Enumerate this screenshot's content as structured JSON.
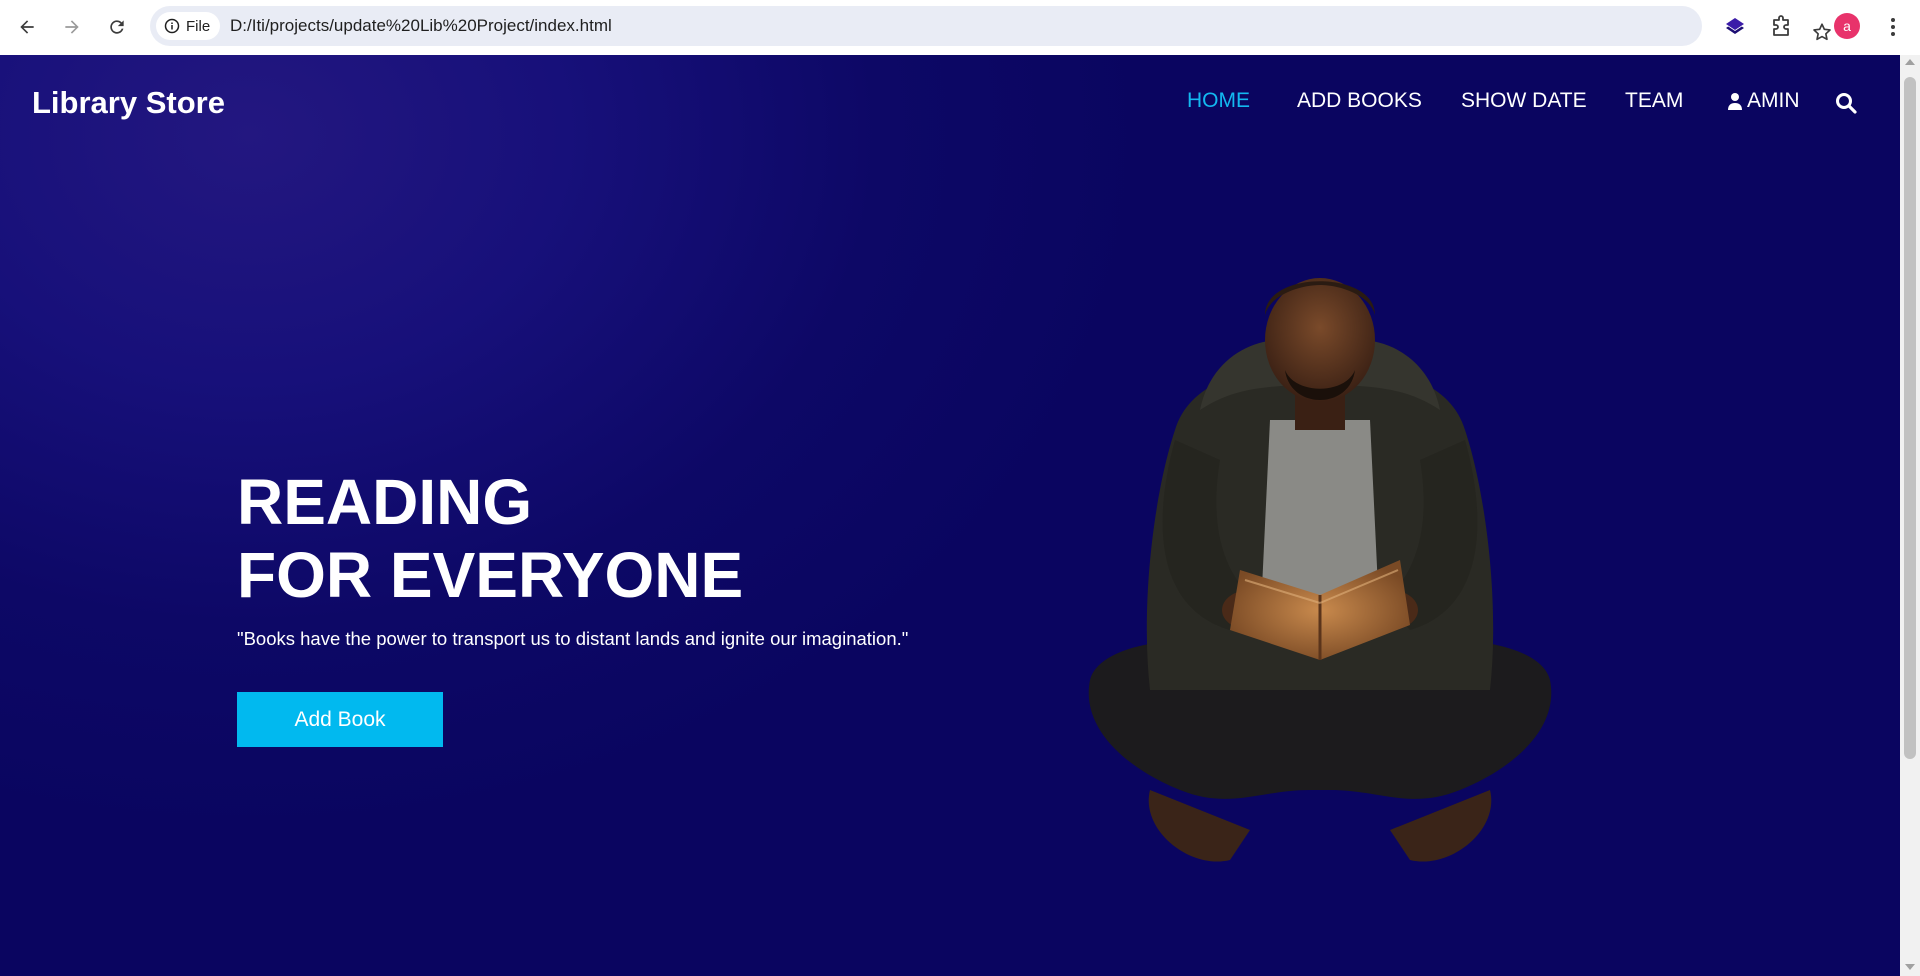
{
  "browser": {
    "site_chip_label": "File",
    "url": "D:/Iti/projects/update%20Lib%20Project/index.html",
    "profile_initial": "a"
  },
  "site": {
    "brand": "Library Store",
    "nav": {
      "home": "HOME",
      "add_books": "ADD BOOKS",
      "show_date": "SHOW DATE",
      "team": "TEAM",
      "user": "AMIN"
    },
    "hero": {
      "title_line1": "READING",
      "title_line2": "FOR EVERYONE",
      "quote": "\"Books have the power to transport us to distant lands and ignite our imagination.\"",
      "button": "Add Book"
    }
  },
  "colors": {
    "accent": "#13b8f0",
    "button": "#01b9ef",
    "background": "#0d0866"
  },
  "icons": [
    "back-icon",
    "forward-icon",
    "reload-icon",
    "info-icon",
    "star-icon",
    "extension-layers-icon",
    "puzzle-icon",
    "kebab-menu-icon",
    "user-icon",
    "search-icon"
  ]
}
